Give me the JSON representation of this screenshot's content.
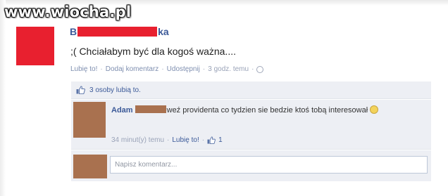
{
  "watermark": "www.wiocha.pl",
  "post": {
    "author_start": "B",
    "author_end": "ka",
    "status": ";( Chciałabym być dla kogoś ważna....",
    "actions": {
      "like": "Lubię to!",
      "comment": "Dodaj komentarz",
      "share": "Udostępnij",
      "time": "3 godz. temu",
      "separator": "·"
    },
    "likes_text": "3 osoby lubią to."
  },
  "comment": {
    "name": "Adam",
    "text": "weź providenta co tydzien sie bedzie ktoś tobą interesował",
    "time": "34 minut(y) temu",
    "like": "Lubię to!",
    "like_count": "1"
  },
  "write_comment": {
    "placeholder": "Napisz komentarz..."
  },
  "colors": {
    "redaction_red": "#e8202f",
    "redaction_brown": "#a9714f",
    "link": "#3b5998",
    "panel": "#edeff4"
  }
}
